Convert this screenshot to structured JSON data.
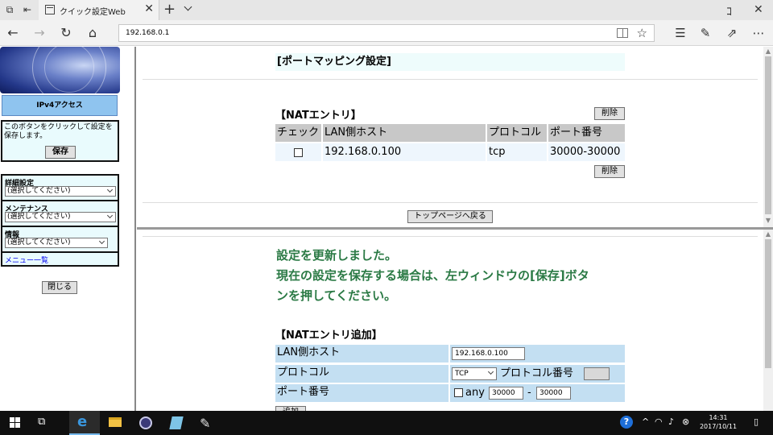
{
  "browser": {
    "tab_title": "クイック設定Web",
    "url": "192.168.0.1",
    "icons": [
      "tab-list-icon",
      "back-tabs-icon",
      "close-icon",
      "new-tab-icon",
      "tab-menu-icon",
      "minimize-icon",
      "close-window-icon",
      "back-icon",
      "forward-icon",
      "refresh-icon",
      "home-icon",
      "reading-view-icon",
      "favorite-star-icon",
      "hub-icon",
      "notes-icon",
      "share-icon",
      "more-icon"
    ]
  },
  "left": {
    "ipv4_label": "IPv4アクセス",
    "save_hint": "このボタンをクリックして設定を保存します。",
    "save_label": "保存",
    "menus": [
      {
        "label": "詳細設定",
        "selected": "(選択してください)"
      },
      {
        "label": "メンテナンス",
        "selected": "(選択してください)"
      },
      {
        "label": "情報",
        "selected": "(選択してください)"
      }
    ],
    "menu_list": "メニュー一覧",
    "close_label": "閉じる"
  },
  "top": {
    "page_title": "[ポートマッピング設定]",
    "nat_title": "【NATエントリ】",
    "delete_label": "削除",
    "headers": [
      "チェック",
      "LAN側ホスト",
      "プロトコル",
      "ポート番号"
    ],
    "row": {
      "host": "192.168.0.100",
      "protocol": "tcp",
      "port": "30000-30000"
    },
    "back_label": "トップページへ戻る"
  },
  "bottom": {
    "message_line1": "設定を更新しました。",
    "message_line2": "現在の設定を保存する場合は、左ウィンドウの[保存]ボタ",
    "message_line3": "ンを押してください。",
    "add_title": "【NATエントリ追加】",
    "lan_host_label": "LAN側ホスト",
    "lan_host_value": "192.168.0.100",
    "protocol_label": "プロトコル",
    "protocol_value": "TCP",
    "protocol_number_label": "プロトコル番号",
    "port_label": "ポート番号",
    "any_label": "any",
    "port_from": "30000",
    "port_sep": "-",
    "port_to": "30000",
    "add_button": "追加"
  },
  "taskbar": {
    "time": "14:31",
    "date": "2017/10/11",
    "accent": "#76b9ed"
  }
}
